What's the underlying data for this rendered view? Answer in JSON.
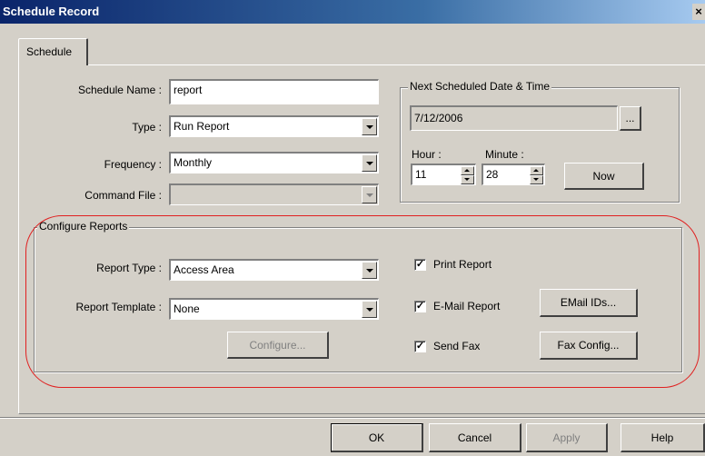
{
  "window": {
    "title": "Schedule Record",
    "close_label": "×"
  },
  "tabs": [
    {
      "label": "Schedule"
    }
  ],
  "schedule": {
    "name_label": "Schedule Name :",
    "name_value": "report",
    "type_label": "Type :",
    "type_value": "Run Report",
    "frequency_label": "Frequency :",
    "frequency_value": "Monthly",
    "command_label": "Command File :",
    "command_value": ""
  },
  "next_scheduled": {
    "group_label": "Next Scheduled Date & Time",
    "date_value": "7/12/2006",
    "browse_label": "...",
    "hour_label": "Hour :",
    "hour_value": "11",
    "minute_label": "Minute :",
    "minute_value": "28",
    "now_label": "Now"
  },
  "configure_reports": {
    "group_label": "Configure Reports",
    "report_type_label": "Report Type :",
    "report_type_value": "Access Area",
    "report_template_label": "Report Template :",
    "report_template_value": "None",
    "configure_label": "Configure...",
    "print_report": {
      "label": "Print Report",
      "checked": true
    },
    "email_report": {
      "label": "E-Mail Report",
      "checked": true
    },
    "send_fax": {
      "label": "Send Fax",
      "checked": true
    },
    "check_mark": "✓",
    "email_ids_label": "EMail IDs...",
    "fax_config_label": "Fax Config..."
  },
  "footer": {
    "ok_label": "OK",
    "cancel_label": "Cancel",
    "apply_label": "Apply",
    "help_label": "Help"
  },
  "annotation": {
    "highlight_color": "#e02020"
  }
}
